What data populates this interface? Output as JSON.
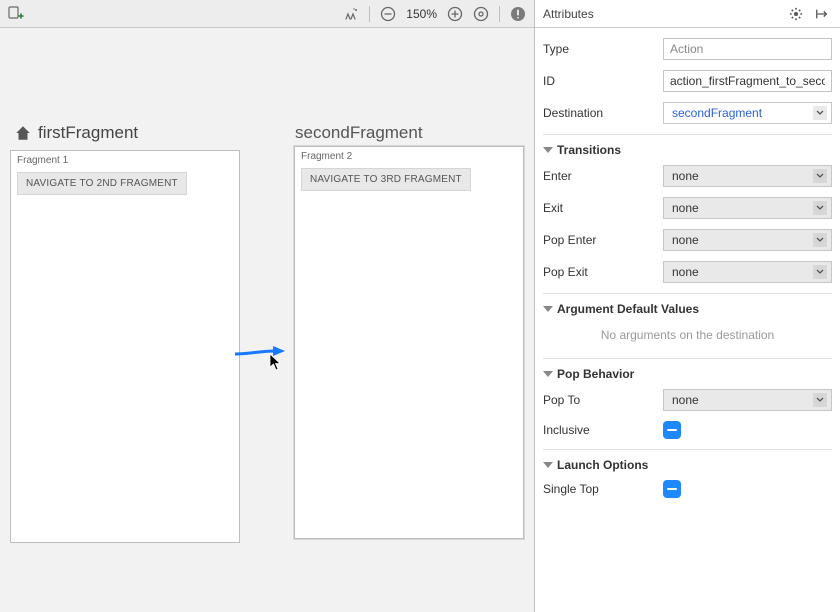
{
  "toolbar": {
    "zoom_text": "150%"
  },
  "canvas": {
    "first_title": "firstFragment",
    "second_title": "secondFragment",
    "first_inner_label": "Fragment 1",
    "second_inner_label": "Fragment 2",
    "first_btn": "NAVIGATE TO 2ND FRAGMENT",
    "second_btn": "NAVIGATE TO 3RD FRAGMENT"
  },
  "attrs": {
    "panel_title": "Attributes",
    "type_label": "Type",
    "type_value": "Action",
    "id_label": "ID",
    "id_value": "action_firstFragment_to_secondFragment",
    "dest_label": "Destination",
    "dest_value": "secondFragment",
    "transitions_head": "Transitions",
    "enter_label": "Enter",
    "exit_label": "Exit",
    "pop_enter_label": "Pop Enter",
    "pop_exit_label": "Pop Exit",
    "none": "none",
    "argdef_head": "Argument Default Values",
    "noargs_text": "No arguments on the destination",
    "popbeh_head": "Pop Behavior",
    "popto_label": "Pop To",
    "inclusive_label": "Inclusive",
    "launch_head": "Launch Options",
    "singletop_label": "Single Top"
  }
}
